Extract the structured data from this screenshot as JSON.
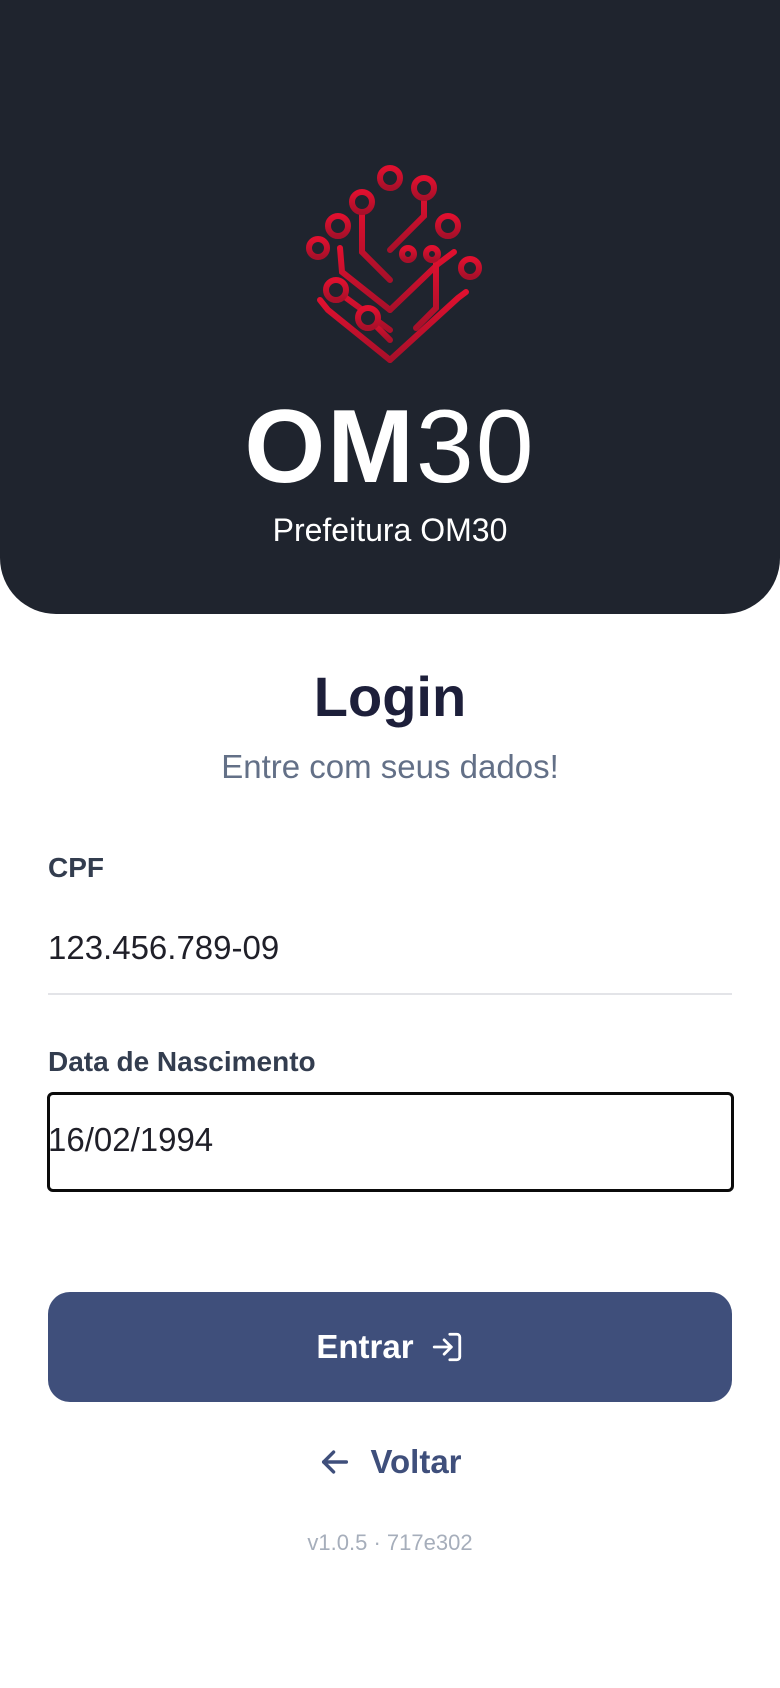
{
  "header": {
    "logo_text_bold": "OM",
    "logo_text_thin": "30",
    "org_name": "Prefeitura OM30"
  },
  "colors": {
    "header_bg": "#1f242e",
    "logo_red": "#d0102e",
    "primary": "#3f4f7b"
  },
  "login": {
    "title": "Login",
    "subtitle": "Entre com seus dados!"
  },
  "form": {
    "cpf_label": "CPF",
    "cpf_value": "123.456.789-09",
    "dob_label": "Data de Nascimento",
    "dob_value": "16/02/1994"
  },
  "actions": {
    "enter_label": "Entrar",
    "enter_icon": "login-icon",
    "back_label": "Voltar",
    "back_icon": "arrow-left-icon"
  },
  "footer": {
    "version": "v1.0.5 · 717e302"
  }
}
